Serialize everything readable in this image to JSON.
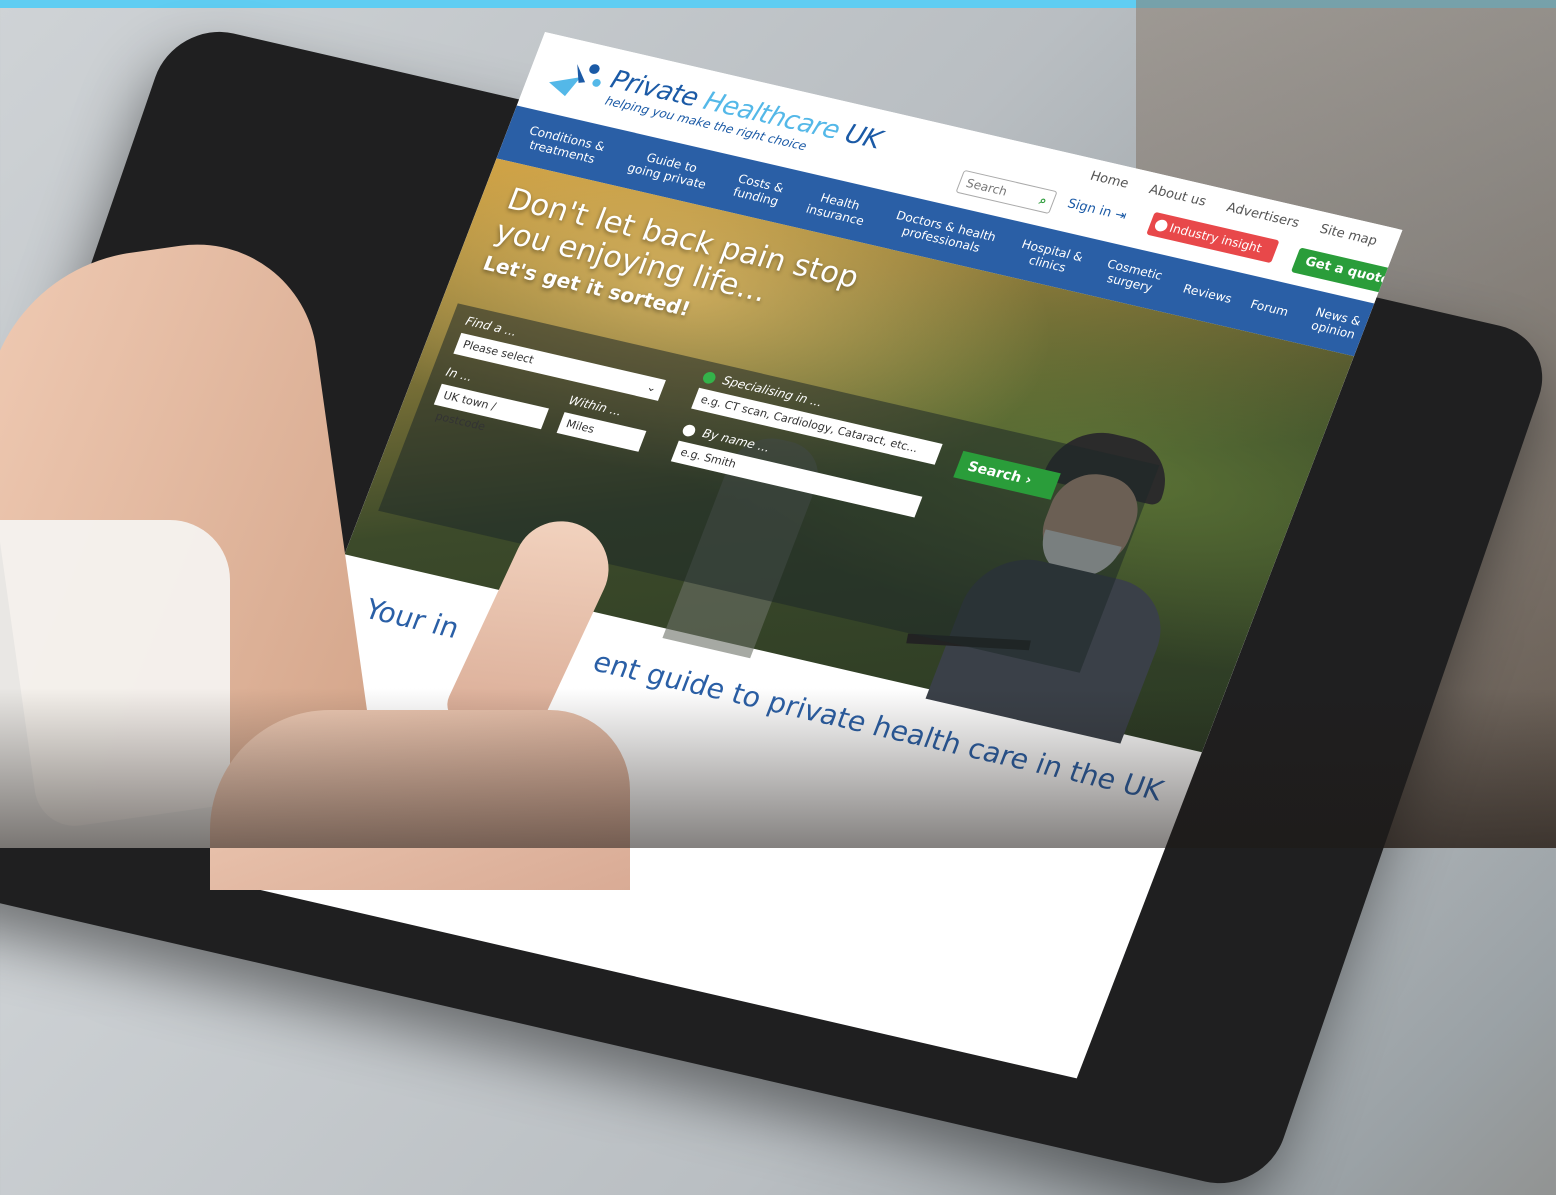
{
  "site": {
    "logo_title_a": "Private ",
    "logo_title_b": "Healthcare",
    "logo_title_c": " UK",
    "logo_tagline": "helping you make the right choice"
  },
  "top_links": [
    "Home",
    "About us",
    "Advertisers",
    "Site map"
  ],
  "header": {
    "search_placeholder": "Search",
    "search_icon": "search-icon",
    "sign_in": "Sign in",
    "industry_insight": "Industry insight",
    "get_quote": "Get a quote"
  },
  "nav": [
    "Conditions & treatments",
    "Guide to going private",
    "Costs & funding",
    "Health insurance",
    "Doctors & health professionals",
    "Hospital & clinics",
    "Cosmetic surgery",
    "Reviews",
    "Forum",
    "News & opinion"
  ],
  "hero": {
    "headline": "Don't let back pain stop you enjoying life...",
    "subheadline": "Let's get it sorted!"
  },
  "finder": {
    "find_label": "Find a ...",
    "find_value": "Please select",
    "in_label": "In ...",
    "in_placeholder": "UK town / postcode",
    "within_label": "Within ...",
    "within_placeholder": "Miles",
    "specialising_label": "Specialising in ...",
    "specialising_placeholder": "e.g. CT scan, Cardiology, Cataract, etc...",
    "byname_label": "By name ...",
    "byname_placeholder": "e.g. Smith",
    "search_button": "Search"
  },
  "tagline_a": "Your in",
  "tagline_b": "ent guide to private health care in the UK",
  "colors": {
    "brand_blue": "#2a5fa6",
    "accent_green": "#2a9d3a",
    "alert_red": "#e8484a",
    "top_strip": "#5fcdf2"
  }
}
